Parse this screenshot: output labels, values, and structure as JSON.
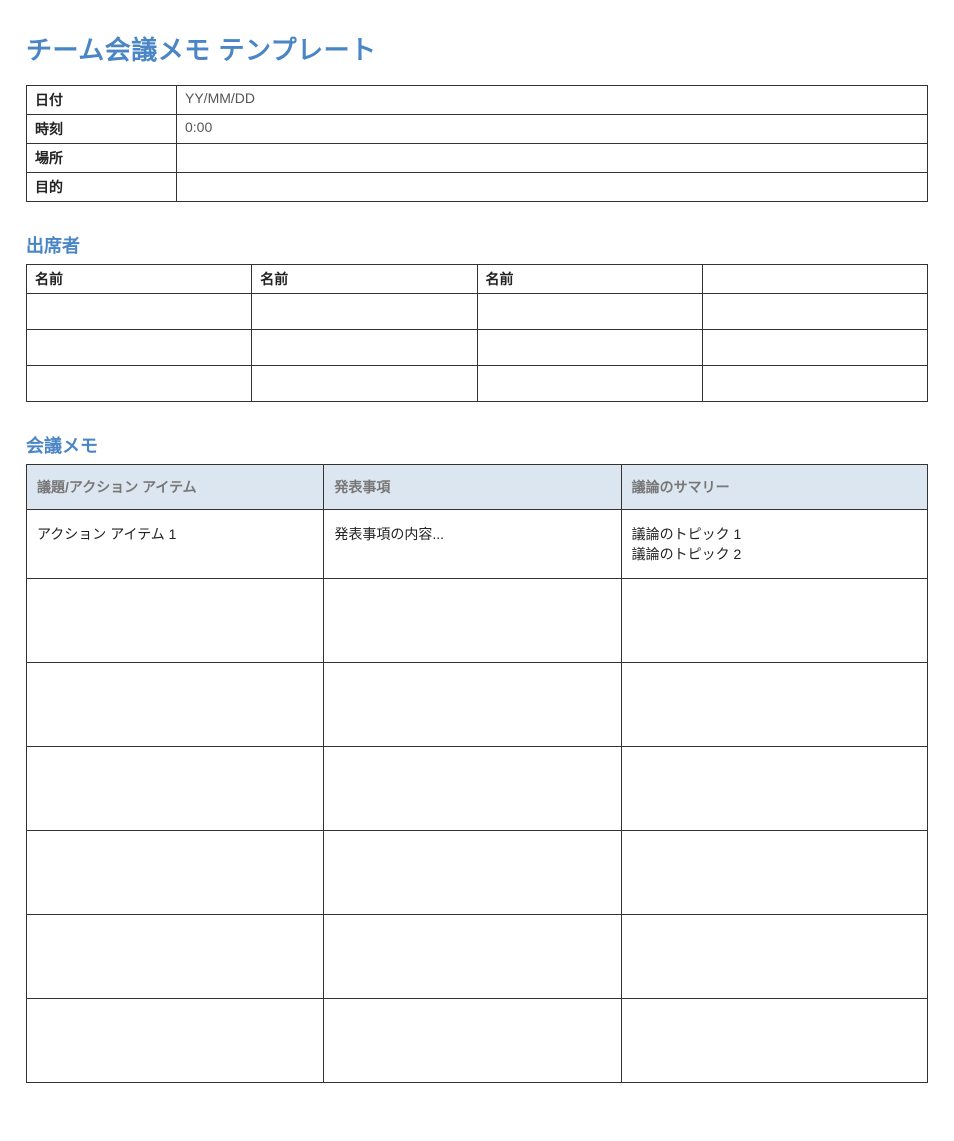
{
  "title": "チーム会議メモ テンプレート",
  "info": {
    "date_label": "日付",
    "date_value": "YY/MM/DD",
    "time_label": "時刻",
    "time_value": "0:00",
    "place_label": "場所",
    "place_value": "",
    "purpose_label": "目的",
    "purpose_value": ""
  },
  "attendees": {
    "heading": "出席者",
    "col1": "名前",
    "col2": "名前",
    "col3": "名前",
    "col4": ""
  },
  "notes": {
    "heading": "会議メモ",
    "col_agenda": "議題/アクション アイテム",
    "col_present": "発表事項",
    "col_summary": "議論のサマリー",
    "row1_agenda": "アクション アイテム 1",
    "row1_present": "発表事項の内容...",
    "row1_topic1": "議論のトピック 1",
    "row1_topic2": "議論のトピック 2"
  }
}
